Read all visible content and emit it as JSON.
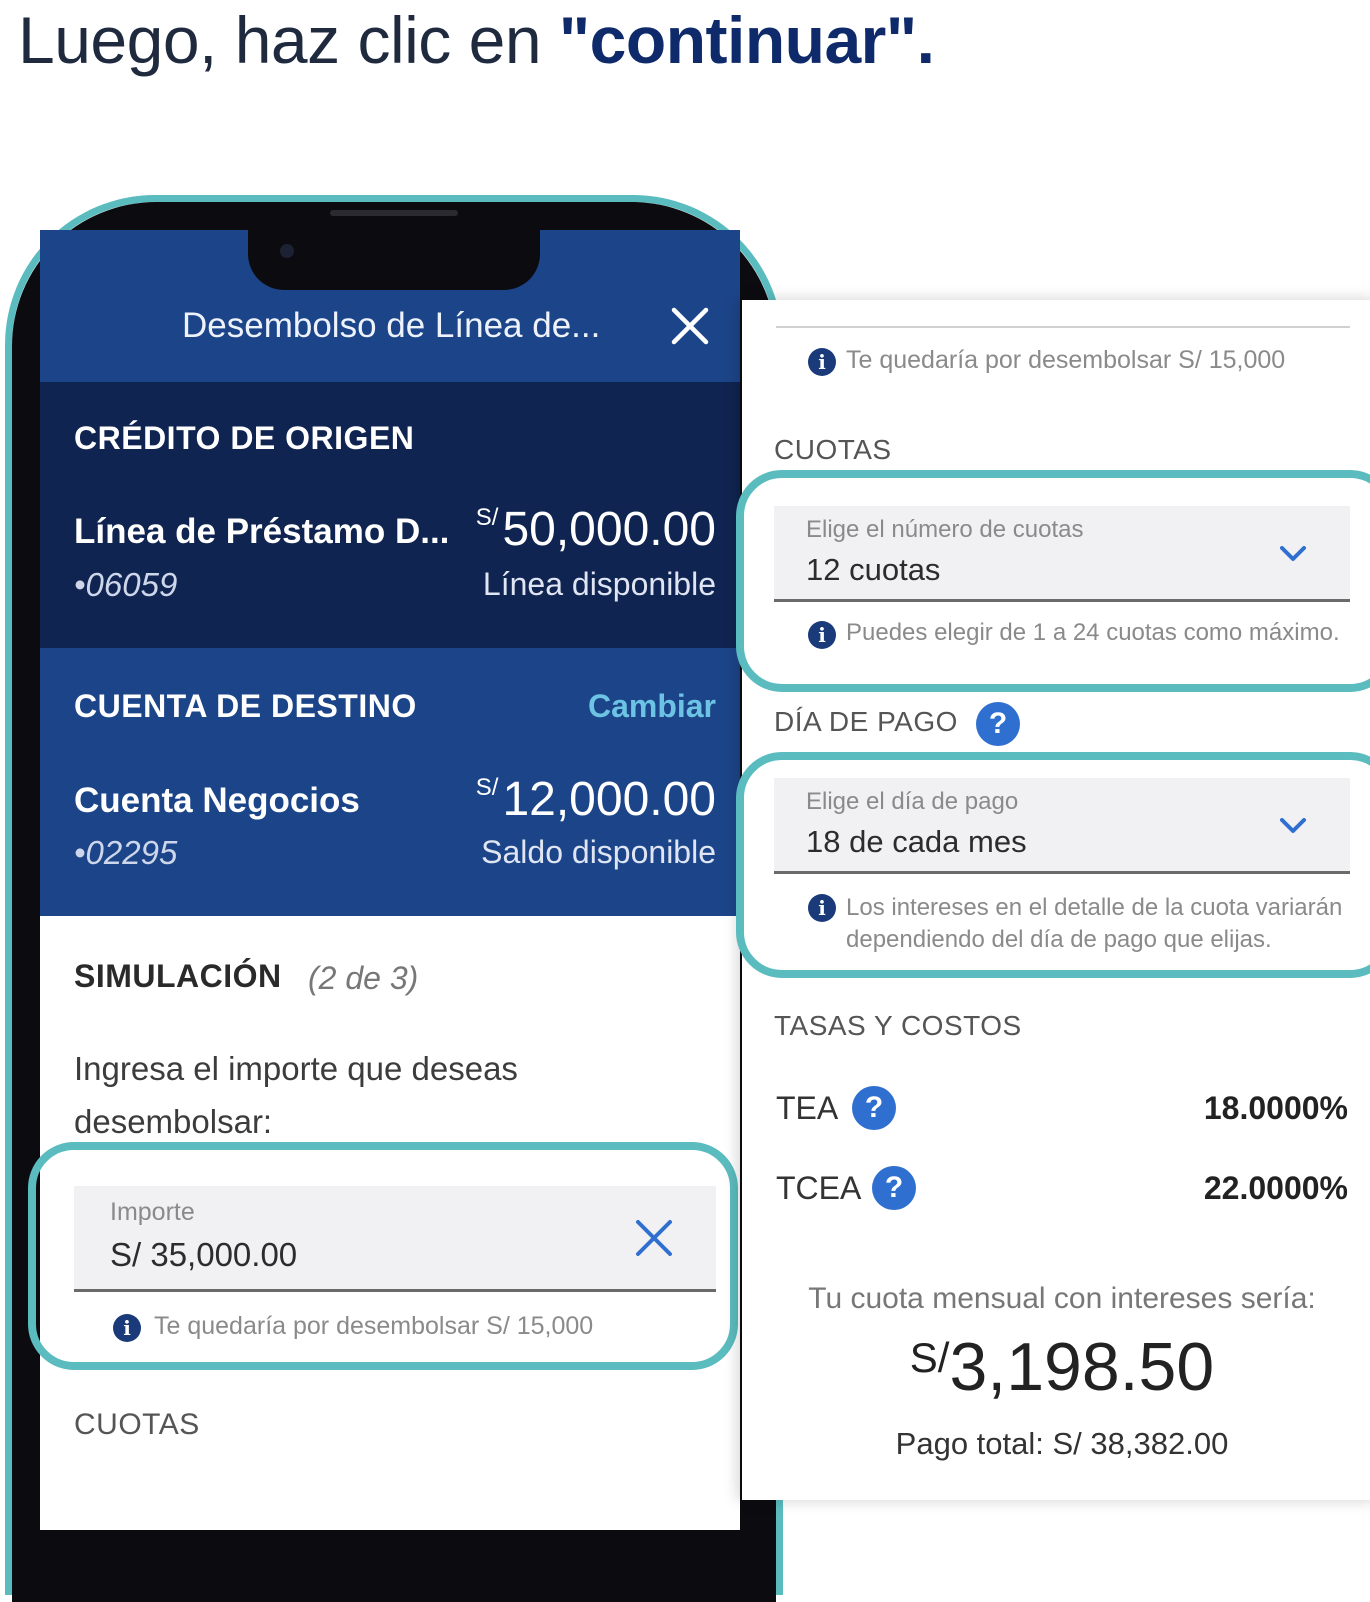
{
  "headline": {
    "prefix": "Luego, haz clic en ",
    "emphasis": "\"continuar\"."
  },
  "header": {
    "title": "Desembolso de Línea de..."
  },
  "origin": {
    "section_title": "CRÉDITO DE ORIGEN",
    "account_name": "Línea de Préstamo D...",
    "account_number": "•06059",
    "currency": "S/",
    "amount": "50,000.00",
    "amount_caption": "Línea disponible"
  },
  "destination": {
    "section_title": "CUENTA DE DESTINO",
    "change_label": "Cambiar",
    "account_name": "Cuenta Negocios",
    "account_number": "•02295",
    "currency": "S/",
    "amount": "12,000.00",
    "amount_caption": "Saldo disponible"
  },
  "simulation": {
    "title": "SIMULACIÓN",
    "step": "(2 de 3)",
    "prompt_line1": "Ingresa el importe que deseas",
    "prompt_line2": "desembolsar:",
    "amount_field": {
      "label": "Importe",
      "value": "S/ 35,000.00"
    },
    "amount_hint": "Te quedaría por desembolsar S/ 15,000",
    "cuotas_head": "CUOTAS"
  },
  "right": {
    "top_hint": "Te quedaría por desembolsar S/ 15,000",
    "cuotas_head": "CUOTAS",
    "cuotas_field": {
      "label": "Elige el número de cuotas",
      "value": "12 cuotas"
    },
    "cuotas_hint": "Puedes elegir de 1 a 24 cuotas como máximo.",
    "dia_head": "DÍA DE PAGO",
    "dia_field": {
      "label": "Elige el día de pago",
      "value": "18 de cada mes"
    },
    "dia_hint_line1": "Los intereses en el detalle de la cuota variarán",
    "dia_hint_line2": "dependiendo del día de pago que elijas.",
    "tasas_head": "TASAS Y COSTOS",
    "tea_label": "TEA",
    "tea_value": "18.0000%",
    "tcea_label": "TCEA",
    "tcea_value": "22.0000%",
    "monthly_caption": "Tu cuota mensual con intereses sería:",
    "monthly_currency": "S/",
    "monthly_amount": "3,198.50",
    "total_payment": "Pago total: S/ 38,382.00"
  },
  "colors": {
    "navy": "#0f2450",
    "blue": "#1c4589",
    "teal": "#5bbcbf",
    "info": "#1a3a7a",
    "help": "#2f6fd0"
  }
}
